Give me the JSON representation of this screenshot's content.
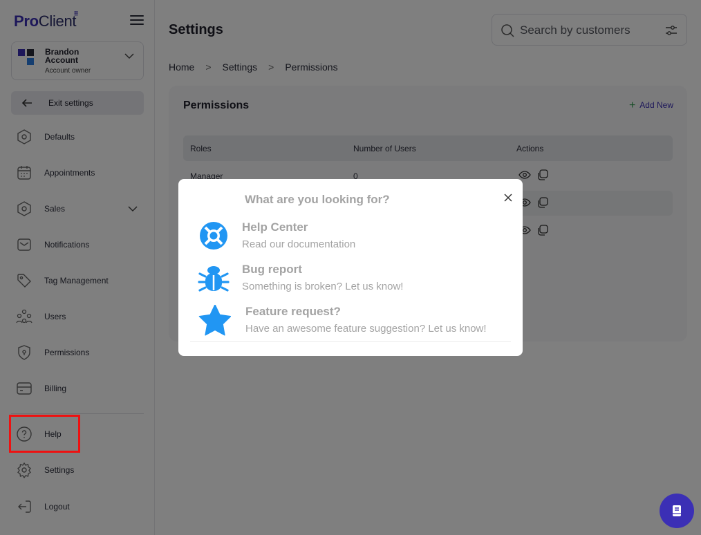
{
  "brand": {
    "pro": "Pro",
    "client": "Client"
  },
  "account": {
    "name": "Brandon Account",
    "role": "Account owner"
  },
  "sidebar": {
    "exit_label": "Exit settings",
    "items": [
      {
        "label": "Defaults",
        "icon": "hexagon-icon"
      },
      {
        "label": "Appointments",
        "icon": "calendar-icon"
      },
      {
        "label": "Sales",
        "icon": "hexagon-icon"
      },
      {
        "label": "Notifications",
        "icon": "mail-icon"
      },
      {
        "label": "Tag Management",
        "icon": "tag-icon"
      },
      {
        "label": "Users",
        "icon": "users-icon"
      },
      {
        "label": "Permissions",
        "icon": "shield-icon"
      },
      {
        "label": "Billing",
        "icon": "card-icon"
      }
    ],
    "bottom": [
      {
        "label": "Help",
        "icon": "help-icon"
      },
      {
        "label": "Settings",
        "icon": "gear-icon"
      },
      {
        "label": "Logout",
        "icon": "logout-icon"
      }
    ]
  },
  "header": {
    "title": "Settings",
    "search_placeholder": "Search by customers"
  },
  "breadcrumb": [
    "Home",
    "Settings",
    "Permissions"
  ],
  "card": {
    "title": "Permissions",
    "add_label": "Add New",
    "columns": [
      "Roles",
      "Number of Users",
      "Actions"
    ],
    "rows": [
      {
        "role": "Manager",
        "users": "0"
      }
    ]
  },
  "modal": {
    "title": "What are you looking for?",
    "items": [
      {
        "title": "Help Center",
        "subtitle": "Read our documentation",
        "icon": "lifebuoy-icon"
      },
      {
        "title": "Bug report",
        "subtitle": "Something is broken? Let us know!",
        "icon": "bug-icon"
      },
      {
        "title": "Feature request?",
        "subtitle": "Have an awesome feature suggestion? Let us know!",
        "icon": "star-icon"
      }
    ]
  },
  "colors": {
    "brand": "#3b2fb5",
    "modal_icon": "#2196f3",
    "highlight": "#e11111"
  }
}
